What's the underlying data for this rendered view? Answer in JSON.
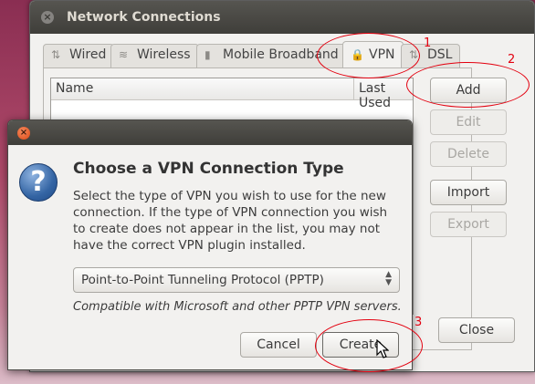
{
  "nc_window": {
    "title": "Network Connections",
    "tabs": [
      {
        "label": "Wired"
      },
      {
        "label": "Wireless"
      },
      {
        "label": "Mobile Broadband"
      },
      {
        "label": "VPN"
      },
      {
        "label": "DSL"
      }
    ],
    "active_tab": "VPN",
    "columns": [
      "Name",
      "Last Used"
    ],
    "buttons": {
      "add": "Add",
      "edit": "Edit",
      "delete": "Delete",
      "import": "Import",
      "export": "Export",
      "close": "Close"
    }
  },
  "dialog": {
    "heading": "Choose a VPN Connection Type",
    "body": "Select the type of VPN you wish to use for the new connection.  If the type of VPN connection you wish to create does not appear in the list, you may not have the correct VPN plugin installed.",
    "select_value": "Point-to-Point Tunneling Protocol (PPTP)",
    "note": "Compatible with Microsoft and other PPTP VPN servers.",
    "cancel": "Cancel",
    "create": "Create"
  },
  "annotations": [
    "1",
    "2",
    "3"
  ],
  "colors": {
    "annotation": "#e3000f",
    "titlebar": "#3f3e3a",
    "close_orange": "#dd4814",
    "question_blue": "#3465a4"
  }
}
